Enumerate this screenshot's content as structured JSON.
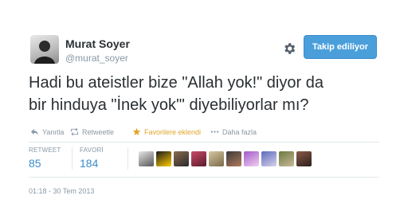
{
  "user": {
    "name": "Murat Soyer",
    "handle": "@murat_soyer"
  },
  "follow_button": {
    "label": "Takip ediliyor",
    "color": "#4a9fdb"
  },
  "settings_icon": "gear-icon",
  "tweet": {
    "line1": "Hadi bu ateistler bize \"Allah yok!\" diyor da",
    "line2": "bir hinduya \"İnek yok'\" diyebiliyorlar mı?"
  },
  "actions": [
    {
      "icon": "reply-icon",
      "label": "Yanıtla"
    },
    {
      "icon": "retweet-icon",
      "label": "Retweetle"
    },
    {
      "icon": "star-icon",
      "label": "Favorilere eklendi",
      "color": "#e0a62c"
    },
    {
      "icon": "more-icon",
      "label": "Daha fazla"
    }
  ],
  "stats": {
    "retweet_label": "RETWEET",
    "retweet_count": "85",
    "fav_label": "FAVORİ",
    "fav_count": "184"
  },
  "favorited_by": [
    {
      "colors": [
        "#e7e7e7",
        "#555555"
      ]
    },
    {
      "colors": [
        "#1a1a1a",
        "#ffcc00"
      ]
    },
    {
      "colors": [
        "#8a6b50",
        "#2b2b2b"
      ]
    },
    {
      "colors": [
        "#c94a6a",
        "#5a1c2a"
      ]
    },
    {
      "colors": [
        "#d6c7a1",
        "#7a6a4a"
      ]
    },
    {
      "colors": [
        "#3a3a3a",
        "#b07a5a"
      ]
    },
    {
      "colors": [
        "#a15acb",
        "#f2d0f0"
      ]
    },
    {
      "colors": [
        "#5a6bbd",
        "#d9d2e9"
      ]
    },
    {
      "colors": [
        "#6b7a3e",
        "#c9b89a"
      ]
    },
    {
      "colors": [
        "#8d5a4a",
        "#2a1f1a"
      ]
    }
  ],
  "timestamp": "01:18 - 30 Tem 2013"
}
